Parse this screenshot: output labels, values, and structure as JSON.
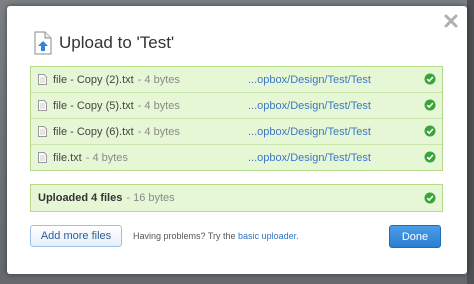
{
  "dialog": {
    "title": "Upload to 'Test'",
    "close_icon": "close-icon",
    "title_icon": "upload-document-icon"
  },
  "files": [
    {
      "name": "file - Copy (2).txt",
      "size": "- 4 bytes",
      "path": "...opbox/Design/Test/Test",
      "status_icon": "check-circle-icon"
    },
    {
      "name": "file - Copy (5).txt",
      "size": "- 4 bytes",
      "path": "...opbox/Design/Test/Test",
      "status_icon": "check-circle-icon"
    },
    {
      "name": "file - Copy (6).txt",
      "size": "- 4 bytes",
      "path": "...opbox/Design/Test/Test",
      "status_icon": "check-circle-icon"
    },
    {
      "name": "file.txt",
      "size": "- 4 bytes",
      "path": "...opbox/Design/Test/Test",
      "status_icon": "check-circle-icon"
    }
  ],
  "summary": {
    "label": "Uploaded 4 files",
    "size": "- 16 bytes",
    "status_icon": "check-circle-icon"
  },
  "footer": {
    "add_button": "Add more files",
    "problems_text": "Having problems? Try the ",
    "basic_uploader_link": "basic uploader",
    "problems_suffix": ".",
    "done_button": "Done"
  },
  "colors": {
    "row_background": "#e6f7d6",
    "row_border": "#b7d98a",
    "check_green": "#3aa43a",
    "link_blue": "#3c78c3",
    "done_blue": "#2c7ed2"
  }
}
